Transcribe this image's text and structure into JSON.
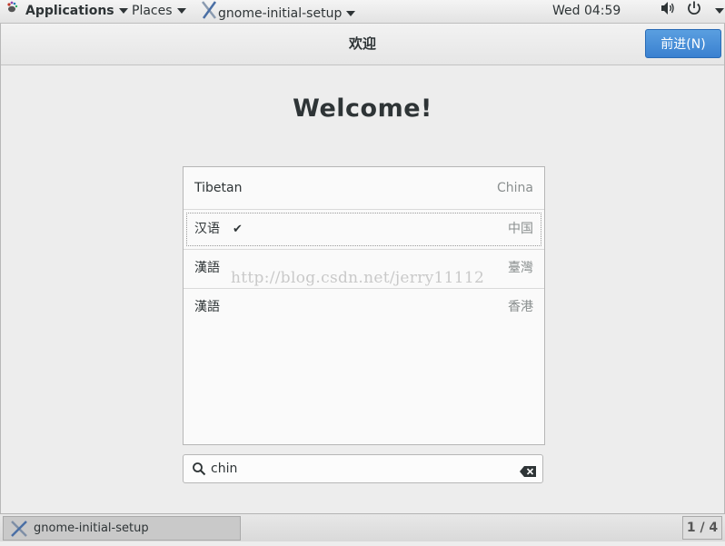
{
  "top_panel": {
    "applications_label": "Applications",
    "places_label": "Places",
    "app_menu_label": "gnome-initial-setup",
    "clock": "Wed 04:59"
  },
  "header": {
    "title": "欢迎",
    "next_button": "前进(N)"
  },
  "main": {
    "heading": "Welcome!",
    "languages": [
      {
        "name": "Tibetan",
        "region": "China",
        "selected": false
      },
      {
        "name": "汉语",
        "region": "中国",
        "selected": true
      },
      {
        "name": "漢語",
        "region": "臺灣",
        "selected": false
      },
      {
        "name": "漢語",
        "region": "香港",
        "selected": false
      }
    ],
    "search": {
      "value": "chin"
    },
    "watermark": "http://blog.csdn.net/jerry11112"
  },
  "bottom_panel": {
    "task_label": "gnome-initial-setup",
    "workspace": "1 / 4"
  },
  "colors": {
    "accent": "#3a81d0",
    "panel": "#e8e8e8",
    "background": "#ededed"
  }
}
